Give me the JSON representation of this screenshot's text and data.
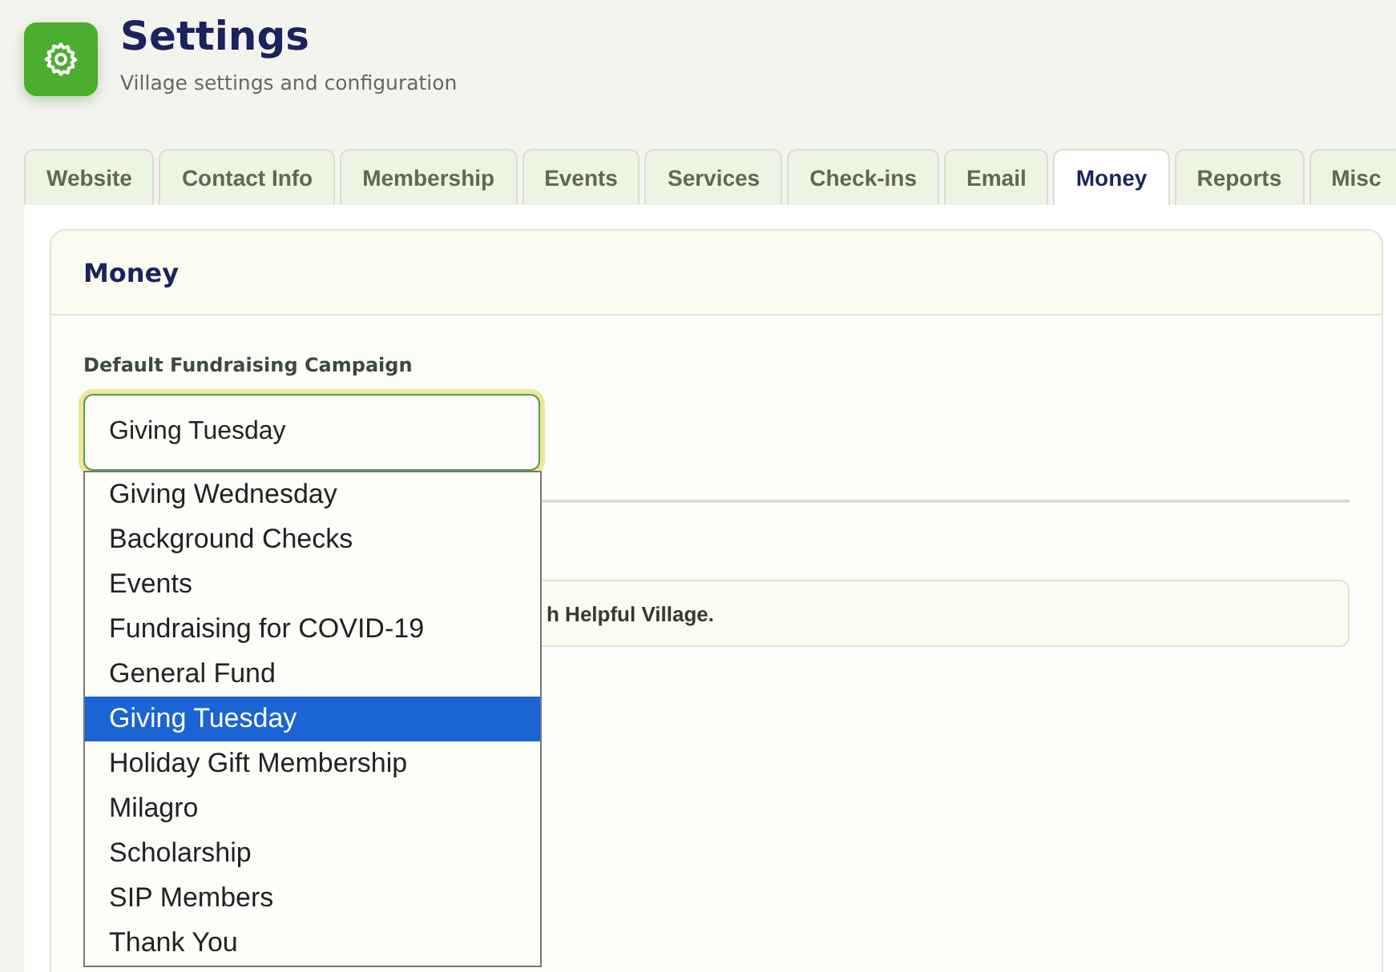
{
  "header": {
    "title": "Settings",
    "subtitle": "Village settings and configuration"
  },
  "tabs": [
    {
      "label": "Website",
      "selected": false
    },
    {
      "label": "Contact Info",
      "selected": false
    },
    {
      "label": "Membership",
      "selected": false
    },
    {
      "label": "Events",
      "selected": false
    },
    {
      "label": "Services",
      "selected": false
    },
    {
      "label": "Check-ins",
      "selected": false
    },
    {
      "label": "Email",
      "selected": false
    },
    {
      "label": "Money",
      "selected": true
    },
    {
      "label": "Reports",
      "selected": false
    },
    {
      "label": "Misc",
      "selected": false
    }
  ],
  "panel": {
    "title": "Money",
    "field": {
      "label": "Default Fundraising Campaign",
      "value": "Giving Tuesday",
      "expanded": true,
      "options": [
        {
          "label": "Giving Wednesday",
          "selected": false
        },
        {
          "label": "Background Checks",
          "selected": false
        },
        {
          "label": "Events",
          "selected": false
        },
        {
          "label": "Fundraising for COVID-19",
          "selected": false
        },
        {
          "label": "General Fund",
          "selected": false
        },
        {
          "label": "Giving Tuesday",
          "selected": true
        },
        {
          "label": "Holiday Gift Membership",
          "selected": false
        },
        {
          "label": "Milagro",
          "selected": false
        },
        {
          "label": "Scholarship",
          "selected": false
        },
        {
          "label": "SIP Members",
          "selected": false
        },
        {
          "label": "Thank You",
          "selected": false
        }
      ]
    },
    "notice": {
      "text": "h Helpful Village."
    }
  }
}
